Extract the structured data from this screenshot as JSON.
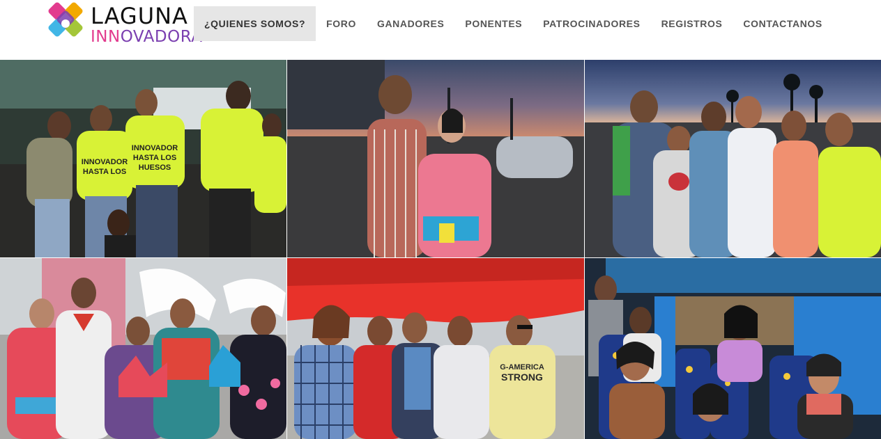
{
  "logo": {
    "line1": "LAGUNA",
    "line2_highlight": "INN",
    "line2_rest": "OVADORA",
    "colors": [
      "#e23b8e",
      "#f2a900",
      "#7b3fb0",
      "#41b6e6",
      "#a4c639"
    ]
  },
  "nav": {
    "items": [
      {
        "label": "¿QUIENES SOMOS?",
        "active": true
      },
      {
        "label": "FORO",
        "active": false
      },
      {
        "label": "GANADORES",
        "active": false
      },
      {
        "label": "PONENTES",
        "active": false
      },
      {
        "label": "PATROCINADORES",
        "active": false
      },
      {
        "label": "REGISTROS",
        "active": false
      },
      {
        "label": "CONTACTANOS",
        "active": false
      }
    ]
  },
  "gallery": {
    "photos": [
      {
        "name": "photo-group-neon-shirts",
        "shirt_text_1": "INNOVADOR",
        "shirt_text_2": "HASTA LOS",
        "shirt_text_3": "HUESOS"
      },
      {
        "name": "photo-couple-parking-lot"
      },
      {
        "name": "photo-group-dusk-palms"
      },
      {
        "name": "photo-traditional-dress"
      },
      {
        "name": "photo-group-red-tent",
        "shirt_text_1": "G-AMERICA",
        "shirt_text_2": "STRONG"
      },
      {
        "name": "photo-bus-interior"
      }
    ]
  }
}
